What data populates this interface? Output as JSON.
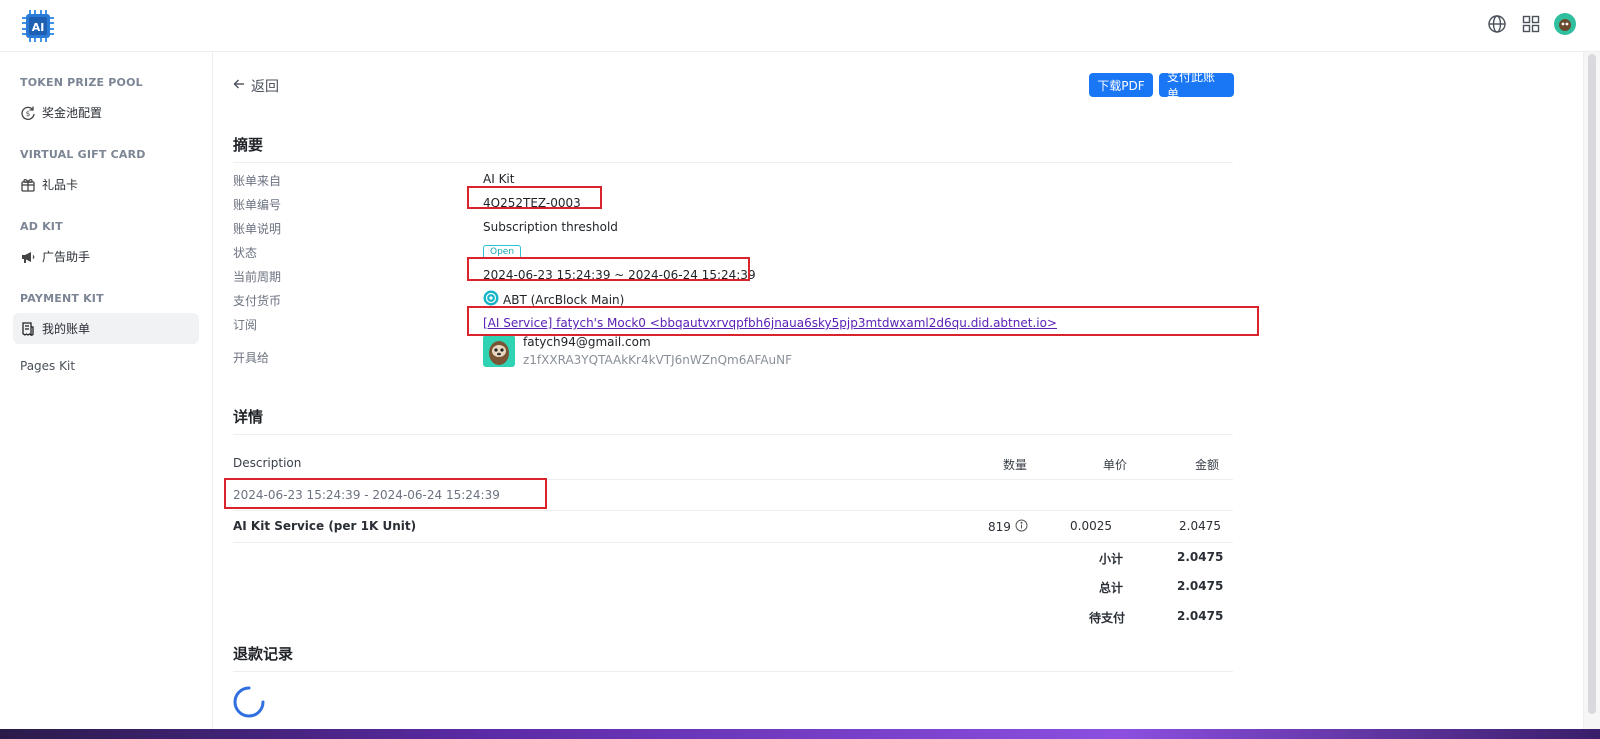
{
  "app": {
    "logo_text": "AI"
  },
  "header": {
    "icons": [
      "globe-icon",
      "apps-grid-icon",
      "user-avatar"
    ]
  },
  "sidebar": {
    "sections": [
      {
        "title": "TOKEN PRIZE POOL",
        "items": [
          {
            "label": "奖金池配置",
            "icon": "prize-pool-icon"
          }
        ]
      },
      {
        "title": "VIRTUAL GIFT CARD",
        "items": [
          {
            "label": "礼品卡",
            "icon": "gift-card-icon"
          }
        ]
      },
      {
        "title": "AD KIT",
        "items": [
          {
            "label": "广告助手",
            "icon": "megaphone-icon"
          }
        ]
      },
      {
        "title": "PAYMENT KIT",
        "items": [
          {
            "label": "我的账单",
            "icon": "receipt-icon",
            "active": true
          }
        ]
      }
    ],
    "pages_kit": "Pages Kit"
  },
  "main": {
    "back_label": "返回",
    "buttons": {
      "download_pdf": "下载PDF",
      "pay_invoice": "支付此账单"
    },
    "summary": {
      "title": "摘要",
      "fields": {
        "from": {
          "label": "账单来自",
          "value": "AI Kit"
        },
        "number": {
          "label": "账单编号",
          "value": "4Q252TEZ-0003"
        },
        "description": {
          "label": "账单说明",
          "value": "Subscription threshold"
        },
        "status": {
          "label": "状态",
          "value": "Open"
        },
        "period": {
          "label": "当前周期",
          "value": "2024-06-23 15:24:39 ~ 2024-06-24 15:24:39"
        },
        "currency": {
          "label": "支付货币",
          "value": "ABT (ArcBlock Main)"
        },
        "subscription": {
          "label": "订阅",
          "value": "[AI Service] fatych's Mock0 <bbqautvxrvqpfbh6jnaua6sky5pjp3mtdwxaml2d6qu.did.abtnet.io>"
        },
        "issued_to": {
          "label": "开具给",
          "email": "fatych94@gmail.com",
          "did": "z1fXXRA3YQTAAkKr4kVTJ6nWZnQm6AFAuNF"
        }
      }
    },
    "details": {
      "title": "详情",
      "columns": {
        "description": "Description",
        "quantity": "数量",
        "unit_price": "单价",
        "amount": "金额"
      },
      "period_row": "2024-06-23 15:24:39 - 2024-06-24 15:24:39",
      "items": [
        {
          "description": "AI Kit Service (per 1K Unit)",
          "quantity": "819",
          "unit_price": "0.0025",
          "amount": "2.0475"
        }
      ],
      "totals": {
        "subtotal": {
          "label": "小计",
          "value": "2.0475"
        },
        "total": {
          "label": "总计",
          "value": "2.0475"
        },
        "due": {
          "label": "待支付",
          "value": "2.0475"
        }
      }
    },
    "refunds": {
      "title": "退款记录"
    }
  },
  "colors": {
    "primary": "#1976f5",
    "highlight": "#d9232d",
    "status_open": "#1aa7b5",
    "link": "#5b21b6"
  }
}
